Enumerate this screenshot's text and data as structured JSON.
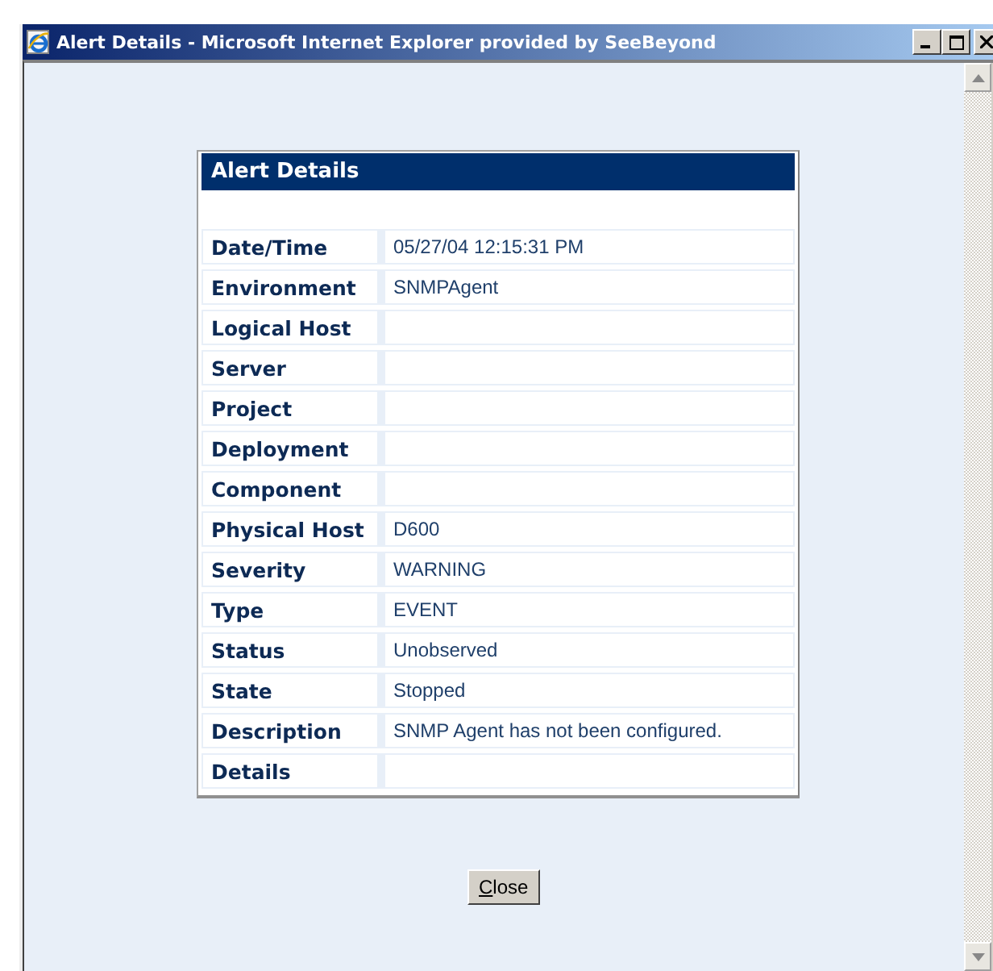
{
  "window": {
    "title": "Alert Details - Microsoft Internet Explorer provided by SeeBeyond"
  },
  "panel": {
    "title": "Alert Details",
    "rows": [
      {
        "label": "Date/Time",
        "value": "05/27/04 12:15:31 PM"
      },
      {
        "label": "Environment",
        "value": "SNMPAgent"
      },
      {
        "label": "Logical Host",
        "value": ""
      },
      {
        "label": "Server",
        "value": ""
      },
      {
        "label": "Project",
        "value": ""
      },
      {
        "label": "Deployment",
        "value": ""
      },
      {
        "label": "Component",
        "value": ""
      },
      {
        "label": "Physical Host",
        "value": "D600"
      },
      {
        "label": "Severity",
        "value": "WARNING"
      },
      {
        "label": "Type",
        "value": "EVENT"
      },
      {
        "label": "Status",
        "value": "Unobserved"
      },
      {
        "label": "State",
        "value": "Stopped"
      },
      {
        "label": "Description",
        "value": "SNMP Agent has not been configured."
      },
      {
        "label": "Details",
        "value": ""
      }
    ]
  },
  "close_button": {
    "label": "Close"
  }
}
